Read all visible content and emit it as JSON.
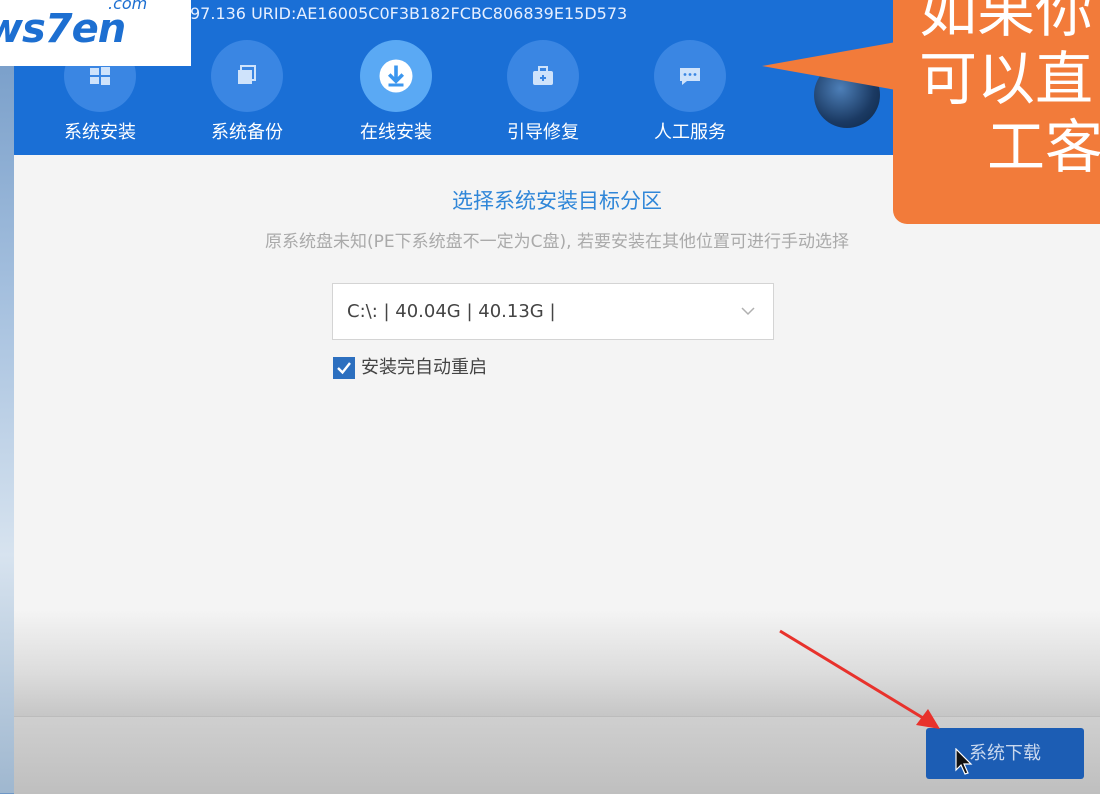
{
  "header": {
    "info_text": "97.136 URID:AE16005C0F3B182FCBC806839E15D573",
    "logo_text": "ws7en",
    "logo_suffix": ".com"
  },
  "nav": {
    "items": [
      {
        "label": "系统安装",
        "icon": "windows-icon"
      },
      {
        "label": "系统备份",
        "icon": "backup-icon"
      },
      {
        "label": "在线安装",
        "icon": "download-icon",
        "active": true
      },
      {
        "label": "引导修复",
        "icon": "toolbox-icon"
      },
      {
        "label": "人工服务",
        "icon": "chat-icon"
      }
    ]
  },
  "callout": {
    "lines": [
      "如果你",
      "可以直",
      "工客"
    ]
  },
  "content": {
    "title": "选择系统安装目标分区",
    "subtitle": "原系统盘未知(PE下系统盘不一定为C盘), 若要安装在其他位置可进行手动选择",
    "partition_select": "C:\\: | 40.04G | 40.13G |",
    "auto_restart_label": "安装完自动重启",
    "auto_restart_checked": true
  },
  "footer": {
    "download_button": "系统下载"
  },
  "colors": {
    "topbar": "#1a6fd6",
    "title": "#2f86d8",
    "button": "#1c5db4",
    "callout": "#f27b3a",
    "annotation_arrow": "#e8322c"
  }
}
